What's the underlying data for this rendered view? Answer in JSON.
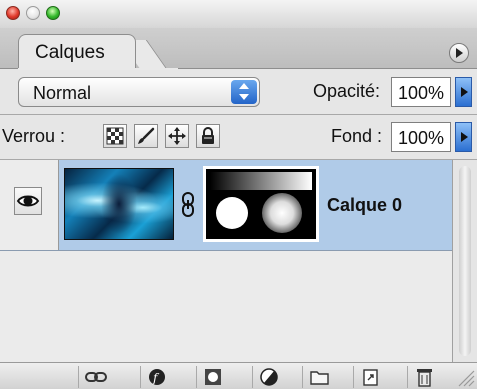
{
  "window": {
    "traffic_lights": [
      "close",
      "minimize",
      "zoom"
    ]
  },
  "tabs": [
    {
      "label": "Calques"
    }
  ],
  "blend": {
    "mode": "Normal",
    "opacity_label": "Opacité:",
    "opacity_value": "100%"
  },
  "lock": {
    "label": "Verrou :",
    "fill_label": "Fond :",
    "fill_value": "100%"
  },
  "layers": [
    {
      "name": "Calque 0",
      "visible": true,
      "selected": true
    }
  ],
  "colors": {
    "selection": "#b0cbe8",
    "accent_blue": "#2b6fd1"
  },
  "toolbar_icons": [
    "link-layers-icon",
    "layer-style-icon",
    "add-mask-icon",
    "adjustment-layer-icon",
    "new-group-icon",
    "new-layer-icon",
    "delete-layer-icon"
  ]
}
